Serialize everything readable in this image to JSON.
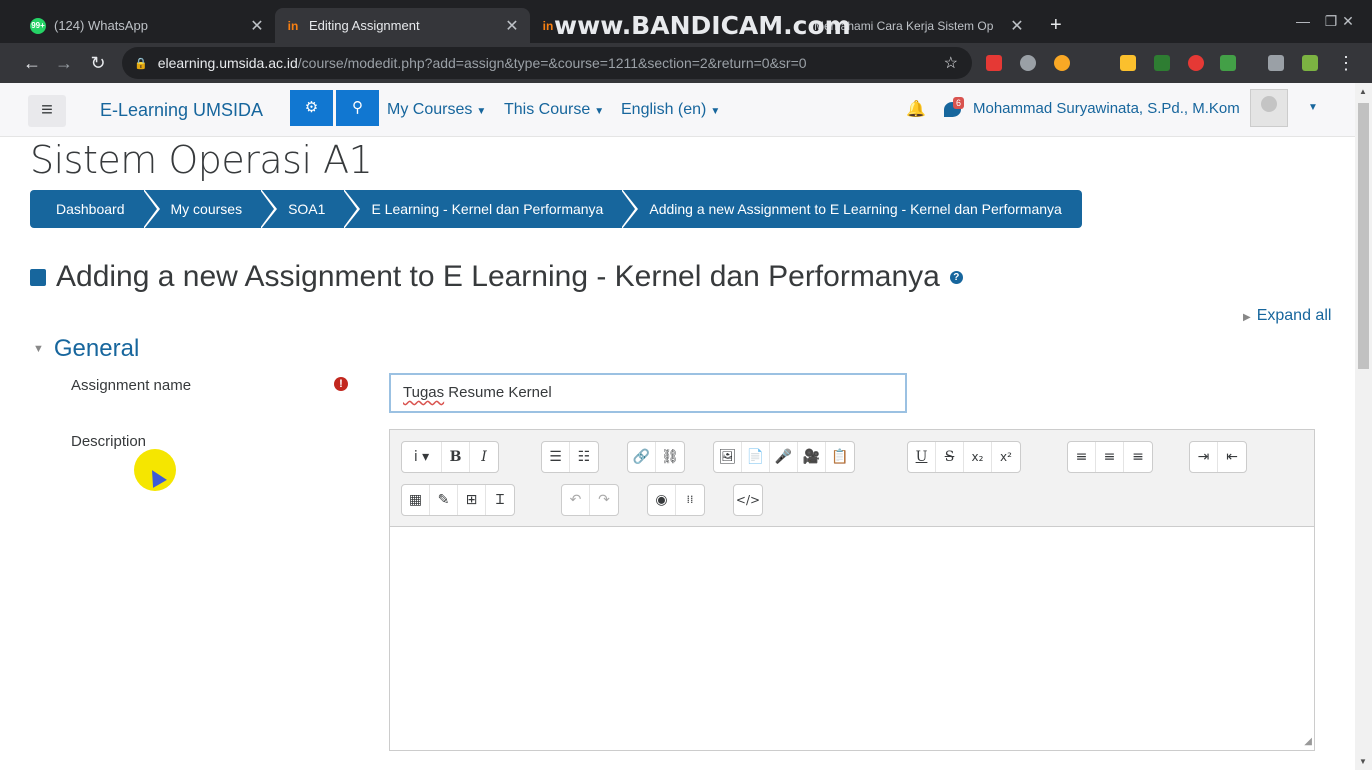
{
  "browser": {
    "tabs": [
      {
        "title": "(124) WhatsApp",
        "favicon_text": "99+",
        "active": false
      },
      {
        "title": "Editing Assignment",
        "favicon_text": "in",
        "active": true
      },
      {
        "title": "Memahami Cara Kerja Sistem Op",
        "favicon_text": "in",
        "active": false
      }
    ],
    "watermark": "www.BANDICAM.com",
    "url_host": "elearning.umsida.ac.id",
    "url_path": "/course/modedit.php?add=assign&type=&course=1211&section=2&return=0&sr=0",
    "colors": {
      "chrome_dark": "#202124",
      "chrome_tab": "#35363a"
    }
  },
  "navbar": {
    "brand": "E-Learning UMSIDA",
    "menus": [
      "My Courses",
      "This Course",
      "English (en)"
    ],
    "message_badge": "6",
    "user_name": "Mohammad Suryawinata, S.Pd., M.Kom"
  },
  "page": {
    "title": "Sistem Operasi A1",
    "breadcrumbs": [
      "Dashboard",
      "My courses",
      "SOA1",
      "E Learning - Kernel dan Performanya",
      "Adding a new Assignment to E Learning - Kernel dan Performanya"
    ],
    "heading": "Adding a new Assignment to E Learning - Kernel dan Performanya",
    "expand_all": "Expand all",
    "section": "General",
    "fields": {
      "assignment_name_label": "Assignment name",
      "assignment_name_value_word1": "Tugas",
      "assignment_name_value_rest": " Resume Kernel",
      "description_label": "Description"
    },
    "accent": "#17669d"
  },
  "editor_toolbar": {
    "row1": [
      "i ▾",
      "B",
      "I",
      "☰",
      "☷",
      "🔗",
      "⛓",
      "🖼",
      "📄",
      "🎤",
      "🎥",
      "📋",
      "U",
      "S",
      "x₂",
      "x²",
      "≡",
      "≡",
      "≡",
      "⇥",
      "⇤"
    ],
    "row2": [
      "▦",
      "✎",
      "⊞",
      "Ɪ",
      "↶",
      "↷",
      "◉",
      "⁞⁞",
      "</>"
    ]
  }
}
